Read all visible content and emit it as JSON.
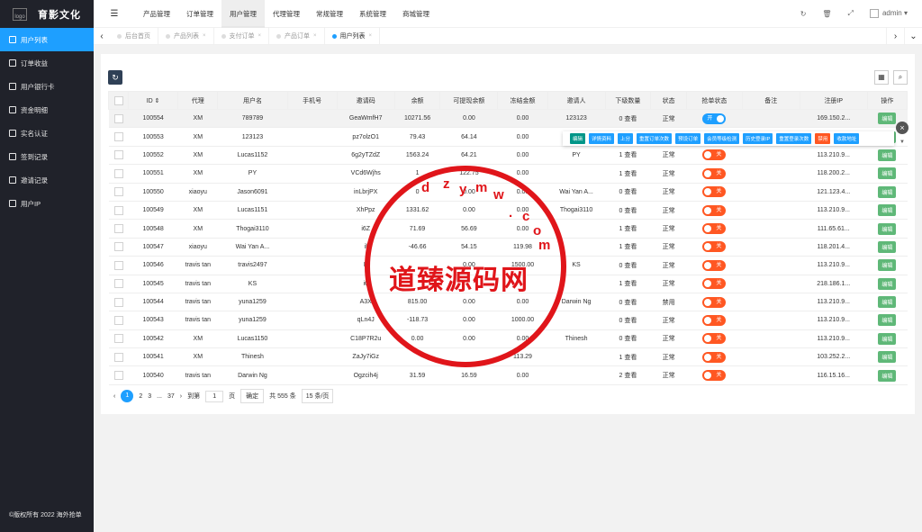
{
  "brand": {
    "logo_alt": "logo",
    "title": "育影文化"
  },
  "sidebar": {
    "items": [
      {
        "label": "用户列表",
        "active": true
      },
      {
        "label": "订单收益"
      },
      {
        "label": "用户银行卡"
      },
      {
        "label": "资金明细"
      },
      {
        "label": "实名认证"
      },
      {
        "label": "签到记录"
      },
      {
        "label": "邀请记录"
      },
      {
        "label": "用户IP"
      }
    ],
    "copyright": "©版权所有 2022 海外抢单"
  },
  "header": {
    "menu": [
      "产品管理",
      "订单管理",
      "用户管理",
      "代理管理",
      "常规管理",
      "系统管理",
      "商城管理"
    ],
    "active": "用户管理",
    "user": "admin"
  },
  "tabs": [
    "后台首页",
    "产品列表",
    "支付订单",
    "产品订单",
    "用户列表"
  ],
  "table": {
    "headers": [
      "ID",
      "代理",
      "用户名",
      "手机号",
      "邀请码",
      "余额",
      "可提现余额",
      "冻结金额",
      "邀请人",
      "下级数量",
      "状态",
      "抢单状态",
      "备注",
      "注册IP",
      "操作"
    ],
    "rows": [
      [
        "100554",
        "XM",
        "789789",
        "",
        "GeaWmfH7",
        "10271.56",
        "0.00",
        "0.00",
        "123123",
        "0 查看",
        "正常",
        "开",
        "",
        "169.150.2...",
        "编辑"
      ],
      [
        "100553",
        "XM",
        "123123",
        "",
        "pz7olzO1",
        "79.43",
        "64.14",
        "0.00",
        "",
        "",
        "",
        "",
        "",
        "",
        "编辑"
      ],
      [
        "100552",
        "XM",
        "Lucas1152",
        "",
        "6g2yTZdZ",
        "1563.24",
        "64.21",
        "0.00",
        "PY",
        "1 查看",
        "正常",
        "关",
        "",
        "113.210.9...",
        "编辑"
      ],
      [
        "100551",
        "XM",
        "PY",
        "",
        "VCd6Wjhs",
        "1",
        "122.75",
        "0.00",
        "",
        "1 查看",
        "正常",
        "关",
        "",
        "118.200.2...",
        "编辑"
      ],
      [
        "100550",
        "xiaoyu",
        "Jason6091",
        "",
        "inLbrjPX",
        "0",
        "0.00",
        "0.00",
        "Wai Yan A...",
        "0 查看",
        "正常",
        "关",
        "",
        "121.123.4...",
        "编辑"
      ],
      [
        "100549",
        "XM",
        "Lucas1151",
        "",
        "XhPpz",
        "1331.62",
        "0.00",
        "0.00",
        "Thogai3110",
        "0 查看",
        "正常",
        "关",
        "",
        "113.210.9...",
        "编辑"
      ],
      [
        "100548",
        "XM",
        "Thogai3110",
        "",
        "i6Z",
        "71.69",
        "56.69",
        "0.00",
        "",
        "1 查看",
        "正常",
        "关",
        "",
        "111.65.61...",
        "编辑"
      ],
      [
        "100547",
        "xiaoyu",
        "Wai Yan A...",
        "",
        "il",
        "-46.66",
        "54.15",
        "119.98",
        "",
        "1 查看",
        "正常",
        "关",
        "",
        "118.201.4...",
        "编辑"
      ],
      [
        "100546",
        "travis tan",
        "travis2497",
        "",
        "K",
        "",
        "0.00",
        "1500.00",
        "KS",
        "0 查看",
        "正常",
        "关",
        "",
        "113.210.9...",
        "编辑"
      ],
      [
        "100545",
        "travis tan",
        "KS",
        "",
        "i6",
        "",
        "",
        "",
        "",
        "1 查看",
        "正常",
        "关",
        "",
        "218.186.1...",
        "编辑"
      ],
      [
        "100544",
        "travis tan",
        "yuna1259",
        "",
        "A3X",
        "815.00",
        "0.00",
        "0.00",
        "Darwin Ng",
        "0 查看",
        "禁用",
        "关",
        "",
        "113.210.9...",
        "编辑"
      ],
      [
        "100543",
        "travis tan",
        "yuna1259",
        "",
        "qLn4J",
        "-118.73",
        "0.00",
        "1000.00",
        "",
        "0 查看",
        "正常",
        "关",
        "",
        "113.210.9...",
        "编辑"
      ],
      [
        "100542",
        "XM",
        "Lucas1150",
        "",
        "C18P7R2u",
        "0.00",
        "0.00",
        "0.00",
        "Thinesh",
        "0 查看",
        "正常",
        "关",
        "",
        "113.210.9...",
        "编辑"
      ],
      [
        "100541",
        "XM",
        "Thinesh",
        "",
        "ZaJy7iGz",
        "",
        "",
        "113.29",
        "",
        "1 查看",
        "正常",
        "关",
        "",
        "103.252.2...",
        "编辑"
      ],
      [
        "100540",
        "travis tan",
        "Darwin Ng",
        "",
        "Ogzcih4j",
        "31.59",
        "16.59",
        "0.00",
        "",
        "2 查看",
        "正常",
        "关",
        "",
        "116.15.16...",
        "编辑"
      ]
    ]
  },
  "row_actions": [
    {
      "label": "编辑",
      "color": "green"
    },
    {
      "label": "详情资料"
    },
    {
      "label": "上分"
    },
    {
      "label": "重置订单次数"
    },
    {
      "label": "预设订单"
    },
    {
      "label": "会员等级检测"
    },
    {
      "label": "历史登录IP"
    },
    {
      "label": "重置登录次数"
    },
    {
      "label": "禁用",
      "color": "red"
    },
    {
      "label": "收款地址"
    }
  ],
  "pager": {
    "pages": [
      "1",
      "2",
      "3",
      "...",
      "37"
    ],
    "current": "1",
    "goto_label": "到第",
    "goto_value": "1",
    "page_unit": "页",
    "confirm": "确定",
    "total": "共 555 条",
    "per_page": "15 条/页"
  },
  "watermark": {
    "text": "道臻源码网",
    "letters": [
      "d",
      "z",
      "y",
      "m",
      "w",
      ".",
      "c",
      "o",
      "m"
    ]
  },
  "icons": {
    "refresh": "refresh-icon",
    "columns": "columns-icon",
    "search": "search-icon"
  },
  "colors": {
    "sidebar": "#20222a",
    "accent": "#1e9fff",
    "edit": "#5fb878",
    "switch_off": "#ff5722",
    "watermark": "#e0151a"
  }
}
